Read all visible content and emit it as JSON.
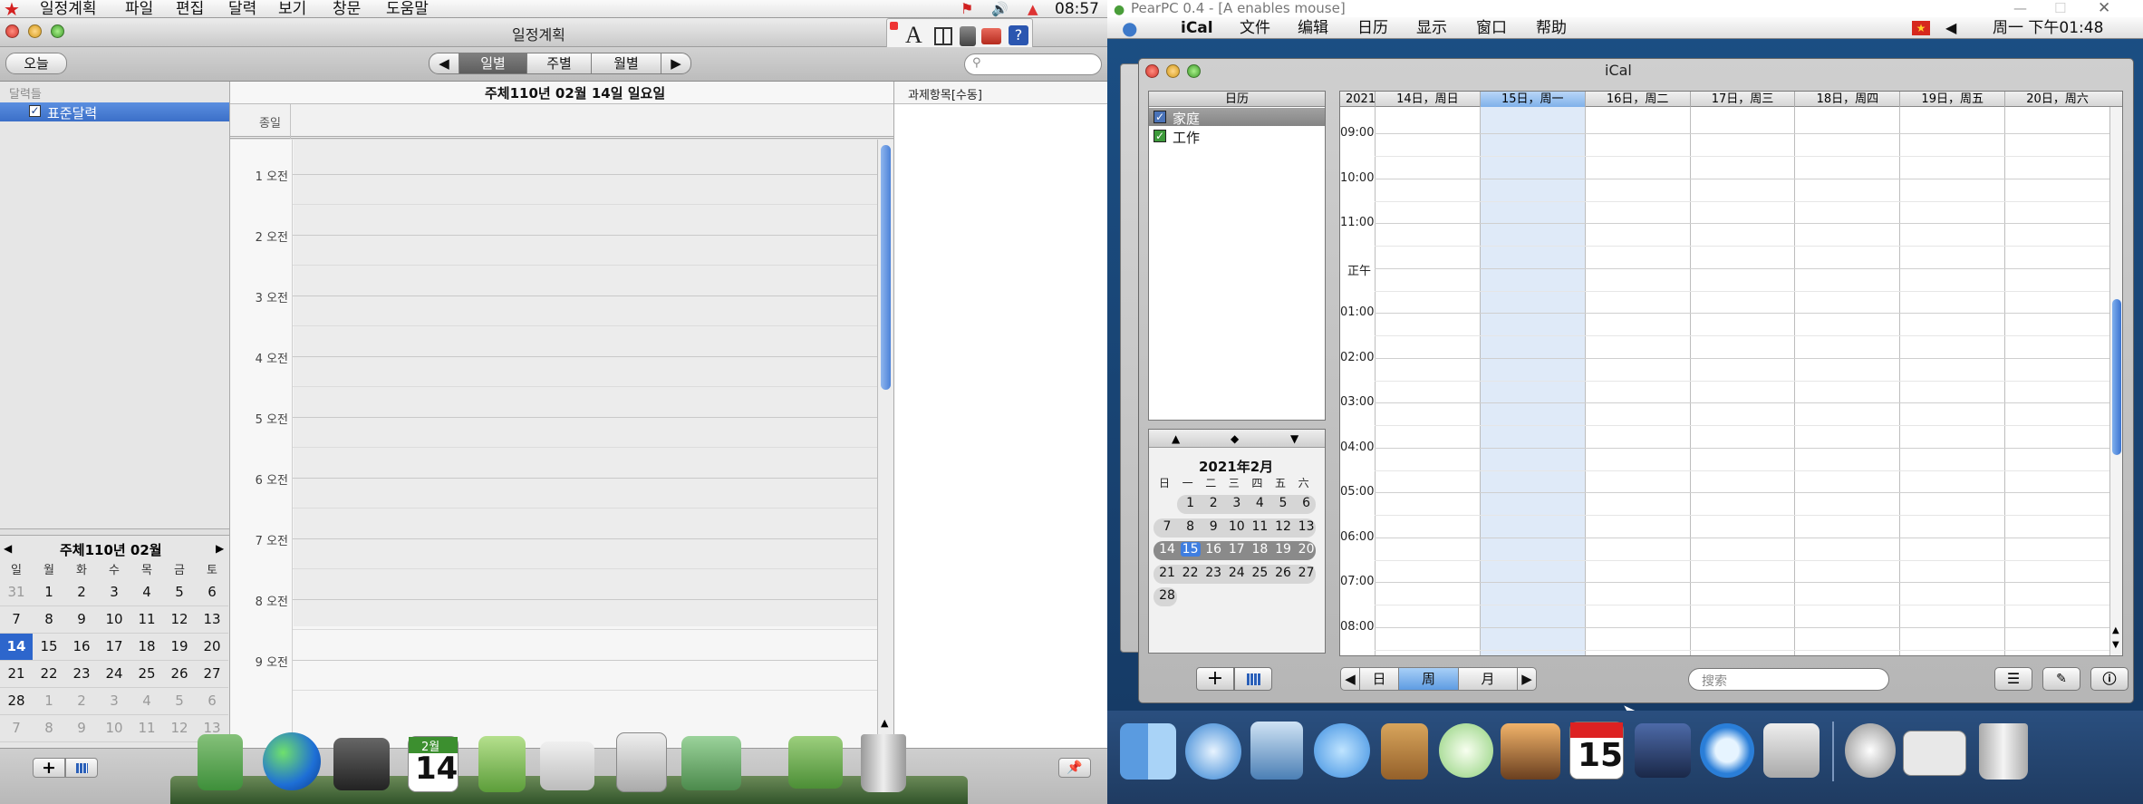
{
  "left": {
    "menubar": {
      "items": [
        "일정계획",
        "파일",
        "편집",
        "달력",
        "보기",
        "창문",
        "도움말"
      ],
      "clock": "08:57"
    },
    "window_title": "일정계획",
    "toolbar": {
      "today": "오늘",
      "views": [
        "일별",
        "주별",
        "월별"
      ],
      "selected_view": "일별",
      "search_placeholder": "",
      "toolbar_icon_letter": "A"
    },
    "sidebar": {
      "header": "달력들",
      "calendars": [
        {
          "name": "표준달력",
          "checked": true
        }
      ]
    },
    "day_header": "주체110년 02월 14일 일요일",
    "allday_label": "종일",
    "hours": [
      "1 오전",
      "2 오전",
      "3 오전",
      "4 오전",
      "5 오전",
      "6 오전",
      "7 오전",
      "8 오전",
      "9 오전"
    ],
    "task_header": "과제항목[수동]",
    "mini_cal": {
      "title": "주체110년 02월",
      "weekdays": [
        "일",
        "월",
        "화",
        "수",
        "목",
        "금",
        "토"
      ],
      "weeks": [
        [
          "31",
          "1",
          "2",
          "3",
          "4",
          "5",
          "6"
        ],
        [
          "7",
          "8",
          "9",
          "10",
          "11",
          "12",
          "13"
        ],
        [
          "14",
          "15",
          "16",
          "17",
          "18",
          "19",
          "20"
        ],
        [
          "21",
          "22",
          "23",
          "24",
          "25",
          "26",
          "27"
        ],
        [
          "28",
          "1",
          "2",
          "3",
          "4",
          "5",
          "6"
        ],
        [
          "7",
          "8",
          "9",
          "10",
          "11",
          "12",
          "13"
        ]
      ],
      "selected": "14"
    },
    "dock": {
      "date_month": "2월",
      "date_day": "14"
    }
  },
  "right": {
    "host_title": "PearPC 0.4 - [A enables mouse]",
    "menubar": {
      "app": "iCal",
      "items": [
        "文件",
        "编辑",
        "日历",
        "显示",
        "窗口",
        "帮助"
      ],
      "clock": "周一 下午01:48"
    },
    "window_title": "iCal",
    "sidebar": {
      "header": "日历",
      "calendars": [
        {
          "name": "家庭",
          "checked": true,
          "color": "#4a73b8"
        },
        {
          "name": "工作",
          "checked": true,
          "color": "#3d9a3a"
        }
      ]
    },
    "mini_cal": {
      "title": "2021年2月",
      "weekdays": [
        "日",
        "一",
        "二",
        "三",
        "四",
        "五",
        "六"
      ],
      "weeks": [
        [
          "",
          "1",
          "2",
          "3",
          "4",
          "5",
          "6"
        ],
        [
          "7",
          "8",
          "9",
          "10",
          "11",
          "12",
          "13"
        ],
        [
          "14",
          "15",
          "16",
          "17",
          "18",
          "19",
          "20"
        ],
        [
          "21",
          "22",
          "23",
          "24",
          "25",
          "26",
          "27"
        ],
        [
          "28",
          "",
          "",
          "",
          "",
          "",
          ""
        ]
      ],
      "today": "15"
    },
    "week_header": {
      "year": "2021",
      "days": [
        "14日，周日",
        "15日，周一",
        "16日，周二",
        "17日，周三",
        "18日，周四",
        "19日，周五",
        "20日，周六"
      ],
      "today_index": 1
    },
    "hours": [
      "09:00",
      "10:00",
      "11:00",
      "正午",
      "01:00",
      "02:00",
      "03:00",
      "04:00",
      "05:00",
      "06:00",
      "07:00",
      "08:00"
    ],
    "bottom": {
      "views": [
        "日",
        "周",
        "月"
      ],
      "selected_view": "周",
      "search_placeholder": "搜索"
    },
    "dock": {
      "date_day": "15"
    }
  }
}
